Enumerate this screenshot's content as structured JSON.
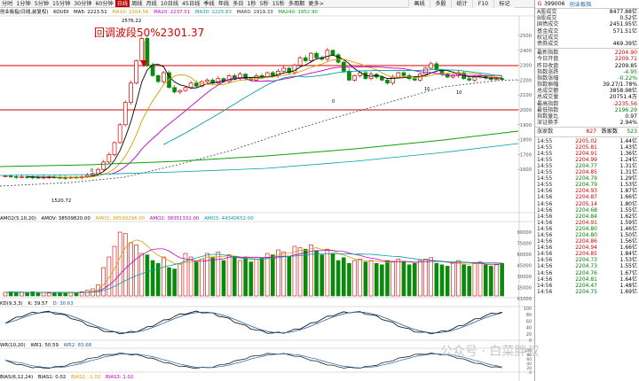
{
  "toolbar": {
    "items": [
      "分时",
      "1分钟",
      "5分钟",
      "15分钟",
      "30分钟",
      "60分钟",
      "日线",
      "周线",
      "月线",
      "10日线",
      "45日线",
      "季线",
      "年线",
      "多日",
      "1秒",
      "5秒",
      "15秒",
      "多周期",
      "更多>"
    ],
    "active_index": 6,
    "right": [
      "画线",
      "多股",
      "统计",
      "F10",
      "标记"
    ]
  },
  "legend_main": {
    "title": "创业板指(日线,前复权)",
    "k": "KOUDI",
    "ma5": "MA5: 2223.51",
    "ma10": "MA10: 2204.56",
    "ma20": "MA20: 2237.51",
    "ma30": "MA30: 2225.83",
    "ma60": "MA60: 1919.33",
    "ma240": "MA240: 1952.90"
  },
  "annotation": "回调波段50%2301.37",
  "labels": {
    "high": "2576.22",
    "low": "1520.72",
    "dr1": "0",
    "dr2": "10",
    "dr3": "10",
    "dr4": "0"
  },
  "price_axis": [
    "2500",
    "2400",
    "2300",
    "2200",
    "2100",
    "2000",
    "1900",
    "1800",
    "1700",
    "1600"
  ],
  "legend_vol": {
    "t": "AMO2(5,10,20)",
    "amov": "AMOV: 38509820.00",
    "amo1": "AMO1: 36593296.00",
    "amo2": "AMO2: 38351332.00",
    "amo3": "AMO3: 44340652.00"
  },
  "vol_axis": [
    "90000",
    "75000",
    "60000",
    "45000",
    "30000",
    "15000",
    "X1000"
  ],
  "legend_kd": {
    "t": "KD(9,3,3)",
    "k": "K: 39.57",
    "d": "D: 30.63"
  },
  "kd_axis": [
    "100",
    "80",
    "60",
    "40",
    "20",
    "0"
  ],
  "legend_wr": {
    "t": "WR(10,20)",
    "wr1": "WR1: 50.59",
    "wr2": "WR2: 83.68"
  },
  "wr_axis": [
    "100",
    "80",
    "60",
    "40",
    "20",
    "0"
  ],
  "legend_bias": {
    "t": "BIAS(6,12,24)",
    "b1": "BIAS1: 0.02",
    "b2": "BIAS2: -1.02",
    "b3": "BIAS3: 1.02"
  },
  "index": {
    "g": "G",
    "code": "399006",
    "name": "创业板指"
  },
  "stats": [
    {
      "l": "A股成交",
      "v": "8477.88亿",
      "c": ""
    },
    {
      "l": "B股成交",
      "v": "0.52亿",
      "c": ""
    },
    {
      "l": "国债成交",
      "v": "2451.95亿",
      "c": ""
    },
    {
      "l": "基金成交",
      "v": "571.51亿",
      "c": ""
    },
    {
      "l": "权证成交",
      "v": "",
      "c": ""
    },
    {
      "l": "债券成交",
      "v": "469.39亿",
      "c": ""
    }
  ],
  "quotes": [
    {
      "l": "最新指数",
      "v": "2204.90",
      "c": "red"
    },
    {
      "l": "今日开盘",
      "v": "2209.71",
      "c": "red"
    },
    {
      "l": "昨日收盘",
      "v": "2209.85",
      "c": ""
    },
    {
      "l": "指数涨跌",
      "v": "-4.95",
      "c": "grn"
    },
    {
      "l": "指数涨幅",
      "v": "-0.22%",
      "c": "grn"
    },
    {
      "l": "指数振幅",
      "v": "39.27/1.78%",
      "c": ""
    },
    {
      "l": "总成交额",
      "v": "3858.98亿",
      "c": ""
    },
    {
      "l": "总成交量",
      "v": "20751.4万",
      "c": ""
    },
    {
      "l": "最高指数",
      "v": "-2235.56",
      "c": "red"
    },
    {
      "l": "最低指数",
      "v": "2196.29",
      "c": "grn"
    },
    {
      "l": "指数量比",
      "v": "0.97",
      "c": ""
    },
    {
      "l": "深证换手",
      "v": "2.94%",
      "c": ""
    }
  ],
  "updown": {
    "up_l": "涨家数",
    "up_v": "827",
    "dn_l": "跌家数",
    "dn_v": "523"
  },
  "ticks": [
    {
      "t": "14:55",
      "p": "2205.02",
      "v": "1.44亿"
    },
    {
      "t": "14:55",
      "p": "2205.81",
      "v": "1.43亿"
    },
    {
      "t": "14:55",
      "p": "2204.91",
      "v": "1.36亿"
    },
    {
      "t": "14:55",
      "p": "2204.99",
      "v": "1.24亿"
    },
    {
      "t": "14:55",
      "p": "2204.77",
      "v": "1.31亿"
    },
    {
      "t": "14:55",
      "p": "2204.85",
      "v": "1.31亿"
    },
    {
      "t": "14:55",
      "p": "2204.79",
      "v": "1.29亿"
    },
    {
      "t": "14:55",
      "p": "2204.79",
      "v": "1.53亿"
    },
    {
      "t": "14:56",
      "p": "2204.93",
      "v": "1.87亿"
    },
    {
      "t": "14:56",
      "p": "2204.87",
      "v": "1.66亿"
    },
    {
      "t": "14:56",
      "p": "2205.14",
      "v": "1.80亿"
    },
    {
      "t": "14:56",
      "p": "2204.68",
      "v": "1.55亿"
    },
    {
      "t": "14:56",
      "p": "2204.84",
      "v": "1.62亿"
    },
    {
      "t": "14:56",
      "p": "2204.91",
      "v": "1.59亿"
    },
    {
      "t": "14:56",
      "p": "2204.80",
      "v": "1.46亿"
    },
    {
      "t": "14:56",
      "p": "2204.80",
      "v": "1.50亿"
    },
    {
      "t": "14:56",
      "p": "2204.86",
      "v": "1.56亿"
    },
    {
      "t": "14:56",
      "p": "2204.94",
      "v": "1.66亿"
    },
    {
      "t": "14:56",
      "p": "2204.85",
      "v": "1.84亿"
    },
    {
      "t": "14:56",
      "p": "2204.73",
      "v": "1.53亿"
    },
    {
      "t": "14:56",
      "p": "2204.73",
      "v": "1.55亿"
    },
    {
      "t": "14:56",
      "p": "2204.76",
      "v": "1.67亿"
    },
    {
      "t": "14:56",
      "p": "2204.81",
      "v": "1.64亿"
    },
    {
      "t": "14:56",
      "p": "2204.47",
      "v": "1.48亿"
    },
    {
      "t": "14:56",
      "p": "2204.75",
      "v": "1.69亿"
    }
  ],
  "watermark": "公众号 · 白菜胖叔",
  "colors": {
    "up": "#d40000",
    "down": "#0a8a0a",
    "ma5": "#000000",
    "ma10": "#d4a000",
    "ma20": "#c000c0",
    "ma30": "#00a0a0",
    "ma60": "#333333",
    "ma240": "#0aa00a"
  }
}
